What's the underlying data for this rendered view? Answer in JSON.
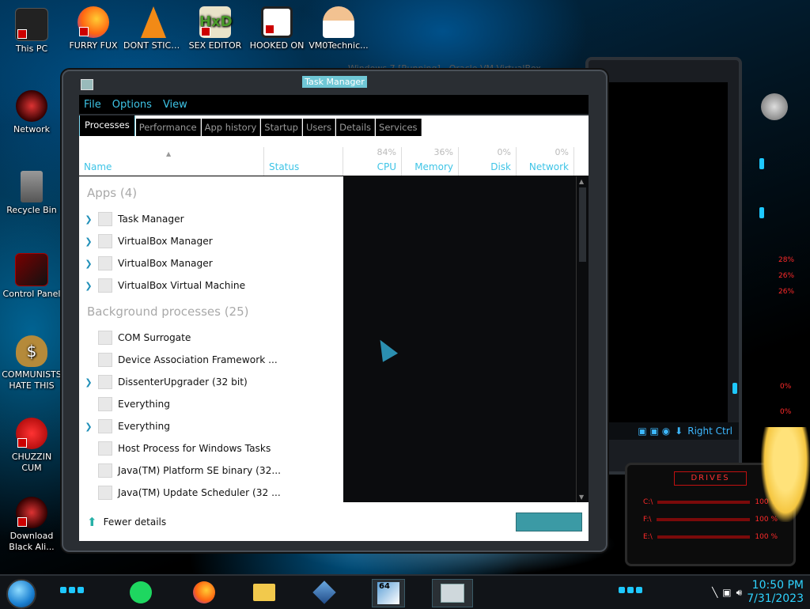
{
  "desktop": {
    "icons": [
      {
        "label": "This PC"
      },
      {
        "label": "Network"
      },
      {
        "label": "Recycle Bin"
      },
      {
        "label": "Control Panel"
      },
      {
        "label": "COMMUNISTS HATE THIS G..."
      },
      {
        "label": "CHUZZIN CUM"
      },
      {
        "label": "Download Black Ali..."
      },
      {
        "label": "FURRY FUX"
      },
      {
        "label": "DONT STICK TI..."
      },
      {
        "label": "SEX EDITOR"
      },
      {
        "label": "HOOKED ON"
      },
      {
        "label": "VM0Technic..."
      }
    ]
  },
  "background_window": {
    "title": "Windows 7 [Running] - Oracle VM VirtualBox",
    "host_key": "Right Ctrl",
    "drives_label": "DRIVES",
    "panel_percents": [
      "28%",
      "26%",
      "26%",
      "0%",
      "0%"
    ],
    "drive_rows": [
      {
        "letter": "C:\\",
        "pct": "100 %"
      },
      {
        "letter": "F:\\",
        "pct": "100 %"
      },
      {
        "letter": "E:\\",
        "pct": "100 %"
      }
    ]
  },
  "task_manager": {
    "title": "Task Manager",
    "menu": [
      "File",
      "Options",
      "View"
    ],
    "tabs": [
      "Processes",
      "Performance",
      "App history",
      "Startup",
      "Users",
      "Details",
      "Services"
    ],
    "active_tab": "Processes",
    "columns": {
      "name": "Name",
      "status": "Status",
      "cpu": {
        "label": "CPU",
        "pct": "84%"
      },
      "memory": {
        "label": "Memory",
        "pct": "36%"
      },
      "disk": {
        "label": "Disk",
        "pct": "0%"
      },
      "network": {
        "label": "Network",
        "pct": "0%"
      }
    },
    "groups": {
      "apps": "Apps (4)",
      "background": "Background processes (25)"
    },
    "apps": [
      {
        "name": "Task Manager",
        "expandable": true
      },
      {
        "name": "VirtualBox Manager",
        "expandable": true
      },
      {
        "name": "VirtualBox Manager",
        "expandable": true
      },
      {
        "name": "VirtualBox Virtual Machine",
        "expandable": true
      }
    ],
    "background": [
      {
        "name": "COM Surrogate",
        "expandable": false
      },
      {
        "name": "Device Association Framework ...",
        "expandable": false
      },
      {
        "name": "DissenterUpgrader (32 bit)",
        "expandable": true
      },
      {
        "name": "Everything",
        "expandable": false
      },
      {
        "name": "Everything",
        "expandable": true
      },
      {
        "name": "Host Process for Windows Tasks",
        "expandable": false
      },
      {
        "name": "Java(TM) Platform SE binary (32...",
        "expandable": false
      },
      {
        "name": "Java(TM) Update Scheduler (32 ...",
        "expandable": false
      }
    ],
    "fewer_details": "Fewer details"
  },
  "taskbar": {
    "time": "10:50 PM",
    "date": "7/31/2023",
    "apps": [
      "Spotify",
      "Firefox",
      "File Explorer",
      "VirtualBox",
      "Windows 7 VM",
      "Task Manager"
    ],
    "vm_badge": "64"
  },
  "colors": {
    "accent": "#3ec4e6",
    "clock": "#2fd3ff",
    "alien_red": "#ff2a2a"
  }
}
